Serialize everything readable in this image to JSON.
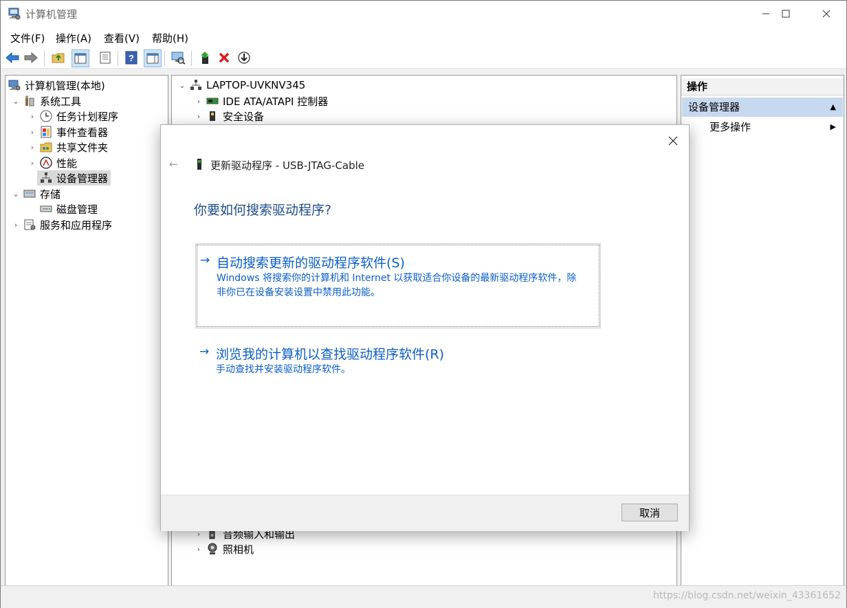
{
  "window": {
    "title": "计算机管理"
  },
  "menu": [
    "文件(F)",
    "操作(A)",
    "查看(V)",
    "帮助(H)"
  ],
  "toolbar": {
    "icons": [
      "back-icon",
      "forward-icon",
      "up-folder-icon",
      "show-tree-icon",
      "properties-icon",
      "help-icon",
      "action-pane-icon",
      "scan-hardware-icon",
      "enable-device-icon",
      "uninstall-icon",
      "update-driver-icon"
    ]
  },
  "tree": {
    "root": "计算机管理(本地)",
    "items": [
      {
        "label": "系统工具"
      },
      {
        "label": "任务计划程序"
      },
      {
        "label": "事件查看器"
      },
      {
        "label": "共享文件夹"
      },
      {
        "label": "性能"
      },
      {
        "label": "设备管理器"
      },
      {
        "label": "存储"
      },
      {
        "label": "磁盘管理"
      },
      {
        "label": "服务和应用程序"
      }
    ]
  },
  "devices": {
    "computer": "LAPTOP-UVKNV345",
    "items": [
      {
        "label": "IDE ATA/ATAPI 控制器"
      },
      {
        "label": "安全设备"
      },
      {
        "label": "音频输入和输出"
      },
      {
        "label": "照相机"
      }
    ]
  },
  "actions": {
    "header": "操作",
    "section": "设备管理器",
    "more": "更多操作"
  },
  "dialog": {
    "title": "更新驱动程序 - USB-JTAG-Cable",
    "heading": "你要如何搜索驱动程序?",
    "option1": {
      "title": "自动搜索更新的驱动程序软件(S)",
      "desc_line1": "Windows 将搜索你的计算机和 Internet 以获取适合你设备的最新驱动程序软件，除",
      "desc_line2": "非你已在设备安装设置中禁用此功能。"
    },
    "option2": {
      "title": "浏览我的计算机以查找驱动程序软件(R)",
      "desc": "手动查找并安装驱动程序软件。"
    },
    "cancel": "取消"
  },
  "watermark": "https://blog.csdn.net/weixin_43361652",
  "colors": {
    "link_blue": "#0b5ec8",
    "heading_blue": "#1e4e8c",
    "selection": "#d9d9d9",
    "action_section": "#c7d9ef"
  }
}
